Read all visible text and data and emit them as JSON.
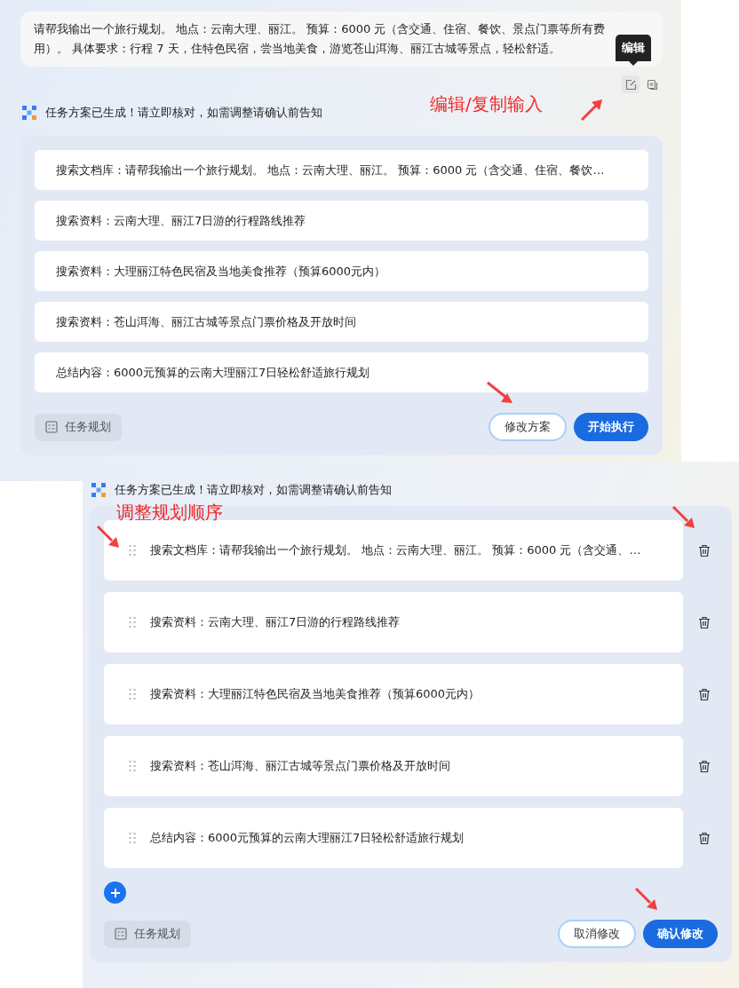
{
  "top": {
    "prompt": "请帮我输出一个旅行规划。 地点：云南大理、丽江。 预算：6000 元（含交通、住宿、餐饮、景点门票等所有费用）。 具体要求：行程 7 天，住特色民宿，尝当地美食，游览苍山洱海、丽江古城等景点，轻松舒适。",
    "tooltip": "编辑",
    "annotation": "编辑/复制输入",
    "notice": "任务方案已生成！请立即核对，如需调整请确认前告知",
    "steps": [
      {
        "text": "搜索文档库：请帮我输出一个旅行规划。 地点：云南大理、丽江。 预算：6000 元（含交通、住宿、餐饮…"
      },
      {
        "text": "搜索资料：云南大理、丽江7日游的行程路线推荐"
      },
      {
        "text": "搜索资料：大理丽江特色民宿及当地美食推荐（预算6000元内）"
      },
      {
        "text": "搜索资料：苍山洱海、丽江古城等景点门票价格及开放时间"
      },
      {
        "text": "总结内容：6000元预算的云南大理丽江7日轻松舒适旅行规划"
      }
    ],
    "tag": "任务规划",
    "buttons": [
      {
        "label": "修改方案",
        "kind": "secondary"
      },
      {
        "label": "开始执行",
        "kind": "primary"
      }
    ]
  },
  "edit": {
    "notice": "任务方案已生成！请立即核对，如需调整请确认前告知",
    "annotation": "调整规划顺序",
    "steps": [
      {
        "text": "搜索文档库：请帮我输出一个旅行规划。 地点：云南大理、丽江。 预算：6000 元（含交通、…"
      },
      {
        "text": "搜索资料：云南大理、丽江7日游的行程路线推荐"
      },
      {
        "text": "搜索资料：大理丽江特色民宿及当地美食推荐（预算6000元内）"
      },
      {
        "text": "搜索资料：苍山洱海、丽江古城等景点门票价格及开放时间"
      },
      {
        "text": "总结内容：6000元预算的云南大理丽江7日轻松舒适旅行规划"
      }
    ],
    "tag": "任务规划",
    "buttons": [
      {
        "label": "取消修改",
        "kind": "secondary"
      },
      {
        "label": "确认修改",
        "kind": "primary"
      }
    ]
  }
}
